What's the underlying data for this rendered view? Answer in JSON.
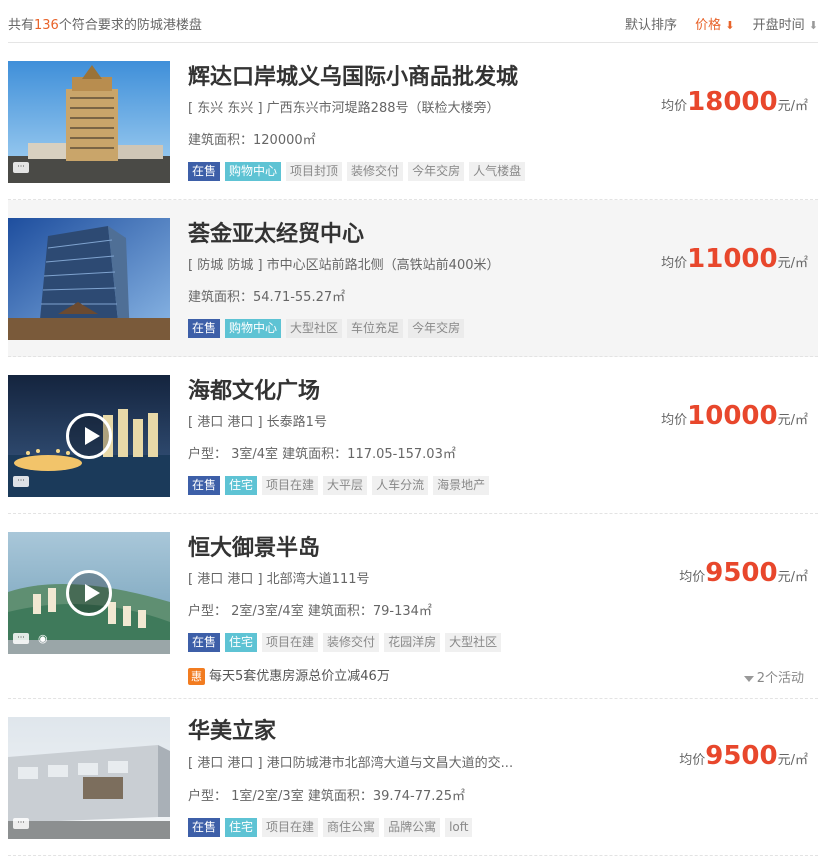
{
  "header": {
    "count_prefix": "共有",
    "count": "136",
    "count_suffix": "个符合要求的防城港楼盘",
    "sort_default": "默认排序",
    "sort_price": "价格",
    "sort_price_arrow": "⬇",
    "sort_open": "开盘时间",
    "sort_open_arrow": "⬇"
  },
  "price_prefix": "均价",
  "price_unit": "元/㎡",
  "listings": [
    {
      "title": "辉达口岸城义乌国际小商品批发城",
      "address": "[ 东兴 东兴 ] 广西东兴市河堤路288号（联检大楼旁）",
      "spec": "建筑面积：120000㎡",
      "price": "18000",
      "status": "在售",
      "type": "购物中心",
      "tags": [
        "项目封顶",
        "装修交付",
        "今年交房",
        "人气楼盘"
      ]
    },
    {
      "title": "荟金亚太经贸中心",
      "address": "[ 防城 防城 ] 市中心区站前路北侧（高铁站前400米）",
      "spec": "建筑面积：54.71-55.27㎡",
      "price": "11000",
      "status": "在售",
      "type": "购物中心",
      "tags": [
        "大型社区",
        "车位充足",
        "今年交房"
      ]
    },
    {
      "title": "海都文化广场",
      "address": "[ 港口 港口 ] 长泰路1号",
      "spec": "户型：  3室/4室   建筑面积：117.05-157.03㎡",
      "price": "10000",
      "status": "在售",
      "type": "住宅",
      "tags": [
        "项目在建",
        "大平层",
        "人车分流",
        "海景地产"
      ]
    },
    {
      "title": "恒大御景半岛",
      "address": "[ 港口 港口 ] 北部湾大道111号",
      "spec": "户型：  2室/3室/4室   建筑面积：79-134㎡",
      "price": "9500",
      "status": "在售",
      "type": "住宅",
      "tags": [
        "项目在建",
        "装修交付",
        "花园洋房",
        "大型社区"
      ],
      "promo_badge": "惠",
      "promo": "每天5套优惠房源总价立减46万",
      "activities": "2个活动"
    },
    {
      "title": "华美立家",
      "address": "[ 港口 港口 ] 港口防城港市北部湾大道与文昌大道的交...",
      "spec": "户型：  1室/2室/3室   建筑面积：39.74-77.25㎡",
      "price": "9500",
      "status": "在售",
      "type": "住宅",
      "tags": [
        "项目在建",
        "商住公寓",
        "品牌公寓",
        "loft"
      ]
    }
  ],
  "icons": {
    "chat": "chat-bubble-icon",
    "vr": "vr-icon",
    "play": "play-icon"
  }
}
